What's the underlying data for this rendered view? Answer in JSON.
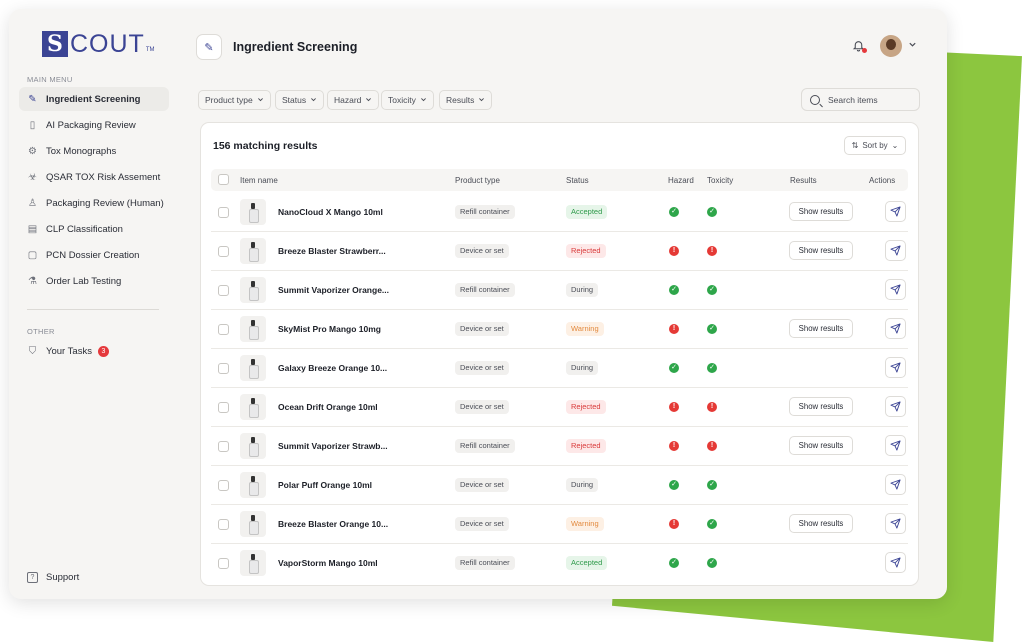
{
  "app": {
    "logo_letter": "S",
    "logo_text": "COUT",
    "logo_tm": "TM"
  },
  "sidebar": {
    "main_menu_label": "MAIN MENU",
    "other_label": "OTHER",
    "items": [
      {
        "label": "Ingredient Screening",
        "icon": "pipette-icon",
        "glyph": "✎"
      },
      {
        "label": "AI Packaging Review",
        "icon": "bottle-icon",
        "glyph": "▯"
      },
      {
        "label": "Tox Monographs",
        "icon": "gear-icon",
        "glyph": "⚙"
      },
      {
        "label": "QSAR TOX Risk Assement",
        "icon": "biohazard-icon",
        "glyph": "☣"
      },
      {
        "label": "Packaging Review (Human)",
        "icon": "user-icon",
        "glyph": "♙"
      },
      {
        "label": "CLP Classification",
        "icon": "document-check-icon",
        "glyph": "▤"
      },
      {
        "label": "PCN Dossier Creation",
        "icon": "document-icon",
        "glyph": "▢"
      },
      {
        "label": "Order Lab Testing",
        "icon": "flask-icon",
        "glyph": "⚗"
      }
    ],
    "tasks": {
      "label": "Your Tasks",
      "count": "3",
      "icon": "shield-check-icon",
      "glyph": "⛉"
    },
    "support": {
      "label": "Support",
      "icon": "help-icon",
      "glyph": "?"
    }
  },
  "header": {
    "title": "Ingredient Screening",
    "icon_glyph": "✎"
  },
  "filters": [
    "Product type",
    "Status",
    "Hazard",
    "Toxicity",
    "Results"
  ],
  "search": {
    "placeholder": "Search items"
  },
  "results": {
    "title": "156 matching results",
    "sort_label": "Sort by",
    "columns": {
      "name": "Item name",
      "type": "Product type",
      "status": "Status",
      "hazard": "Hazard",
      "toxicity": "Toxicity",
      "results": "Results",
      "actions": "Actions"
    },
    "show_label": "Show results",
    "rows": [
      {
        "name": "NanoCloud X Mango 10ml",
        "type": "Refill container",
        "status": "Accepted",
        "hazard": "ok",
        "toxicity": "ok",
        "show": true
      },
      {
        "name": "Breeze Blaster Strawberr...",
        "type": "Device or set",
        "status": "Rejected",
        "hazard": "bad",
        "toxicity": "bad",
        "show": true
      },
      {
        "name": "Summit Vaporizer Orange...",
        "type": "Refill container",
        "status": "During",
        "hazard": "ok",
        "toxicity": "ok",
        "show": false
      },
      {
        "name": "SkyMist Pro Mango 10mg",
        "type": "Device or set",
        "status": "Warning",
        "hazard": "bad",
        "toxicity": "ok",
        "show": true
      },
      {
        "name": "Galaxy Breeze Orange 10...",
        "type": "Device or set",
        "status": "During",
        "hazard": "ok",
        "toxicity": "ok",
        "show": false
      },
      {
        "name": "Ocean Drift Orange 10ml",
        "type": "Device or set",
        "status": "Rejected",
        "hazard": "bad",
        "toxicity": "bad",
        "show": true
      },
      {
        "name": "Summit Vaporizer Strawb...",
        "type": "Refill container",
        "status": "Rejected",
        "hazard": "bad",
        "toxicity": "bad",
        "show": true
      },
      {
        "name": "Polar Puff Orange 10ml",
        "type": "Device or set",
        "status": "During",
        "hazard": "ok",
        "toxicity": "ok",
        "show": false
      },
      {
        "name": "Breeze Blaster Orange 10...",
        "type": "Device or set",
        "status": "Warning",
        "hazard": "bad",
        "toxicity": "ok",
        "show": true
      },
      {
        "name": "VaporStorm Mango 10ml",
        "type": "Refill container",
        "status": "Accepted",
        "hazard": "ok",
        "toxicity": "ok",
        "show": false
      }
    ]
  },
  "colors": {
    "brand": "#3b4494",
    "accent_green": "#8cc63f",
    "ok": "#2ea64a",
    "bad": "#e53935"
  }
}
